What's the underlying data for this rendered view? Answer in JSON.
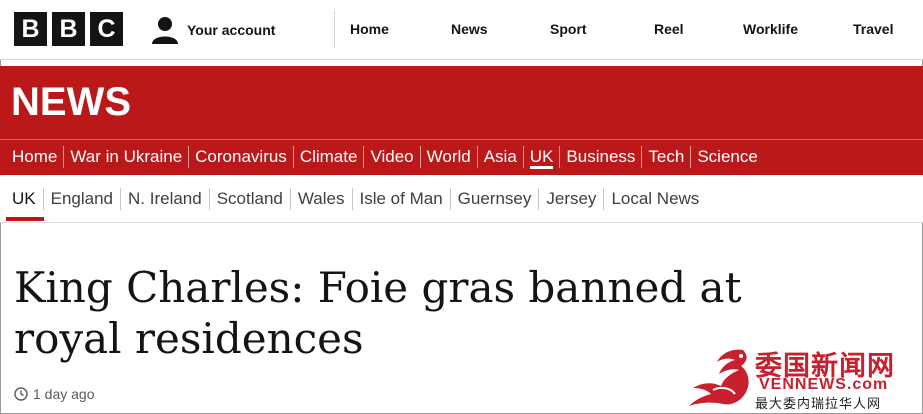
{
  "header": {
    "logo_letters": [
      "B",
      "B",
      "C"
    ],
    "account_label": "Your account",
    "account_icon": "person-icon",
    "nav": [
      {
        "label": "Home"
      },
      {
        "label": "News"
      },
      {
        "label": "Sport"
      },
      {
        "label": "Reel"
      },
      {
        "label": "Worklife"
      },
      {
        "label": "Travel"
      }
    ]
  },
  "news_band": {
    "title": "NEWS",
    "background_color": "#bb1919",
    "nav": [
      {
        "label": "Home"
      },
      {
        "label": "War in Ukraine"
      },
      {
        "label": "Coronavirus"
      },
      {
        "label": "Climate"
      },
      {
        "label": "Video"
      },
      {
        "label": "World"
      },
      {
        "label": "Asia"
      },
      {
        "label": "UK",
        "active": true
      },
      {
        "label": "Business"
      },
      {
        "label": "Tech"
      },
      {
        "label": "Science"
      }
    ]
  },
  "sub_nav": {
    "items": [
      {
        "label": "UK",
        "active": true
      },
      {
        "label": "England"
      },
      {
        "label": "N. Ireland"
      },
      {
        "label": "Scotland"
      },
      {
        "label": "Wales"
      },
      {
        "label": "Isle of Man"
      },
      {
        "label": "Guernsey"
      },
      {
        "label": "Jersey"
      },
      {
        "label": "Local News"
      }
    ]
  },
  "article": {
    "headline_line1": "King Charles: Foie gras banned at",
    "headline_line2": "royal residences",
    "timestamp": "1 day ago",
    "timestamp_icon": "clock-icon"
  },
  "watermark": {
    "chinese_title": "委国新闻网",
    "domain": "VENNEWS.com",
    "tagline": "最大委内瑞拉华人网",
    "icon": "phoenix-logo-icon",
    "color": "#c8202e"
  }
}
